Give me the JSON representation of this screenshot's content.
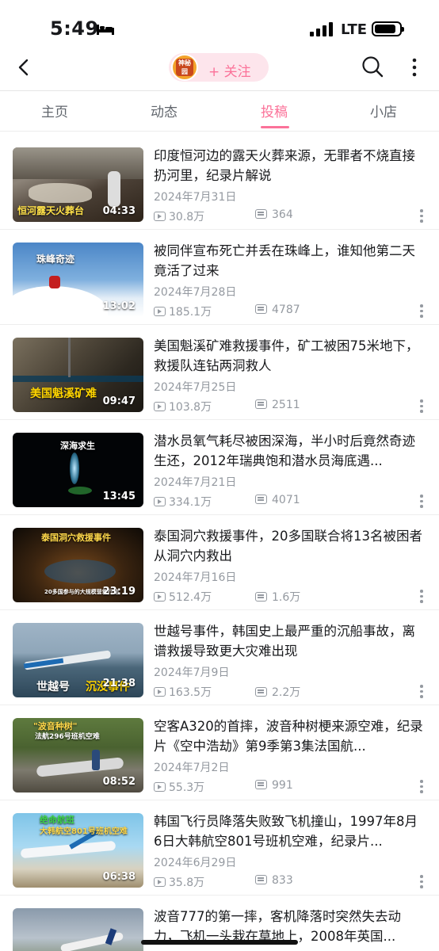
{
  "status_bar": {
    "time": "5:49",
    "network": "LTE"
  },
  "header": {
    "avatar_text": "神秘园",
    "follow_label": "+ 关注"
  },
  "tabs": [
    {
      "label": "主页",
      "active": false
    },
    {
      "label": "动态",
      "active": false
    },
    {
      "label": "投稿",
      "active": true
    },
    {
      "label": "小店",
      "active": false
    }
  ],
  "videos": [
    {
      "title": "印度恒河边的露天火葬来源，无罪者不烧直接扔河里，纪录片解说",
      "date": "2024年7月31日",
      "views": "30.8万",
      "comments": "364",
      "duration": "04:33",
      "caption": "恒河露天火葬台"
    },
    {
      "title": "被同伴宣布死亡并丢在珠峰上，谁知他第二天竟活了过来",
      "date": "2024年7月28日",
      "views": "185.1万",
      "comments": "4787",
      "duration": "13:02",
      "caption": "珠峰奇迹"
    },
    {
      "title": "美国魁溪矿难救援事件，矿工被困75米地下，救援队连钻两洞救人",
      "date": "2024年7月25日",
      "views": "103.8万",
      "comments": "2511",
      "duration": "09:47",
      "caption": "美国魁溪矿难"
    },
    {
      "title": "潜水员氧气耗尽被困深海，半小时后竟然奇迹生还，2012年瑞典饱和潜水员海底遇...",
      "date": "2024年7月21日",
      "views": "334.1万",
      "comments": "4071",
      "duration": "13:45",
      "caption": "深海求生"
    },
    {
      "title": "泰国洞穴救援事件，20多国联合将13名被困者从洞穴内救出",
      "date": "2024年7月16日",
      "views": "512.4万",
      "comments": "1.6万",
      "duration": "23:19",
      "caption": "泰国洞穴救援事件",
      "subcaption": "20多国参与的大规模营救行动"
    },
    {
      "title": "世越号事件，韩国史上最严重的沉船事故，离谱救援导致更大灾难出现",
      "date": "2024年7月9日",
      "views": "163.5万",
      "comments": "2.2万",
      "duration": "21:38",
      "caption": "世越号",
      "caption2": "沉没事件"
    },
    {
      "title": "空客A320的首摔，波音种树梗来源空难，纪录片《空中浩劫》第9季第3集法国航...",
      "date": "2024年7月2日",
      "views": "55.3万",
      "comments": "991",
      "duration": "08:52",
      "caption": "\"波音种树\"",
      "subcaption": "法航296号班机空难"
    },
    {
      "title": "韩国飞行员降落失败致飞机撞山，1997年8月6日大韩航空801号班机空难，纪录片...",
      "date": "2024年6月29日",
      "views": "35.8万",
      "comments": "833",
      "duration": "06:38",
      "caption": "绝命航班",
      "subcaption": "大韩航空801号班机空难"
    },
    {
      "title": "波音777的第一摔，客机降落时突然失去动力，飞机一头栽在草地上，2008年英国...",
      "date": "",
      "views": "",
      "comments": "",
      "duration": "",
      "caption": ""
    }
  ]
}
